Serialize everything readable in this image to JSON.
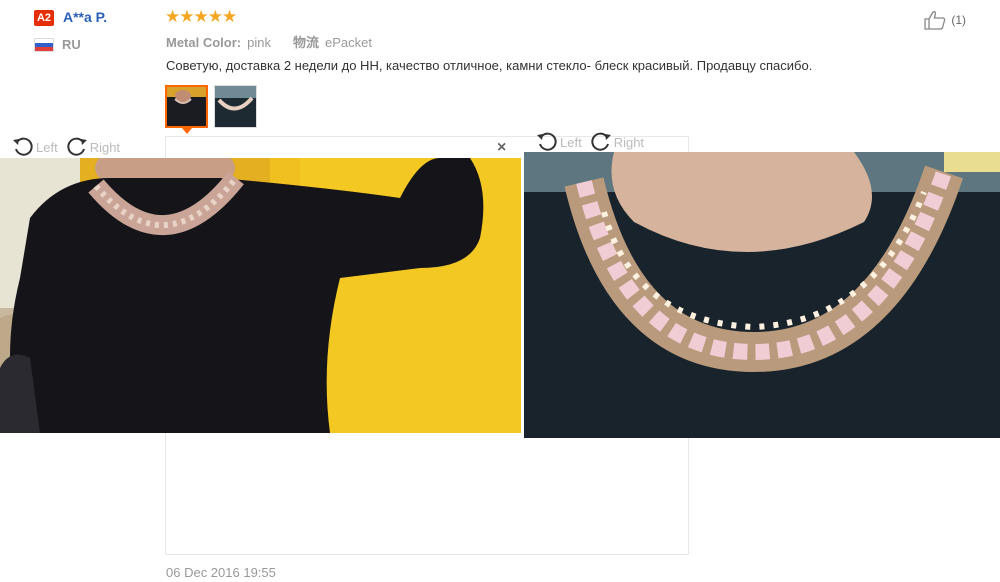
{
  "user": {
    "level_badge": "A2",
    "name": "A**a P.",
    "country_code": "RU",
    "flag_icon": "russia-flag-icon"
  },
  "feedback": {
    "rating": 5,
    "rating_max": 5,
    "attributes": [
      {
        "key": "Metal Color:",
        "value": "pink"
      },
      {
        "key": "物流",
        "value": "ePacket"
      }
    ],
    "text": "Советую, доставка 2 недели до НН, качество отличное, камни стекло- блеск красивый. Продавцу спасибо.",
    "date": "06 Dec 2016 19:55",
    "like_count": "(1)",
    "star_color": "#f5a623",
    "accent_color": "#ff6600"
  },
  "viewer": {
    "rotate_left_label": "Left",
    "rotate_right_label": "Right",
    "close_glyph": "×"
  }
}
